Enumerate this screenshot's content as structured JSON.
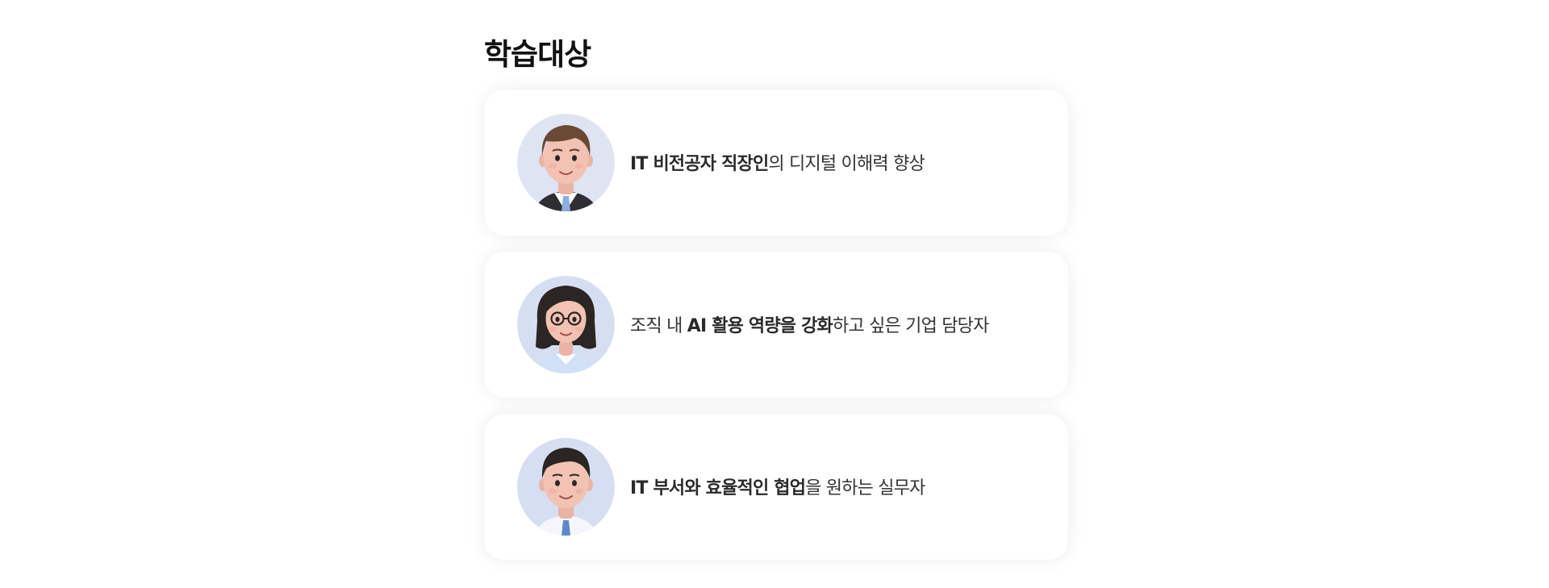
{
  "section": {
    "title": "학습대상"
  },
  "targets": [
    {
      "avatar": "man-in-suit-avatar",
      "text_bold": "IT 비전공자 직장인",
      "text_pre": "",
      "text_post": "의 디지털 이해력 향상"
    },
    {
      "avatar": "woman-with-glasses-avatar",
      "text_pre": "조직 내 ",
      "text_bold": "AI 활용 역량을 강화",
      "text_post": "하고 싶은 기업 담당자"
    },
    {
      "avatar": "young-man-avatar",
      "text_pre": "",
      "text_bold": "IT 부서와 효율적인 협업",
      "text_post": "을 원하는 실무자"
    }
  ],
  "colors": {
    "avatar_bg": "#dfe4f3",
    "skin": "#f2c2b3",
    "hair_brown": "#6a4a35",
    "hair_dark": "#2b2523",
    "tie_blue": "#8eaee0"
  }
}
